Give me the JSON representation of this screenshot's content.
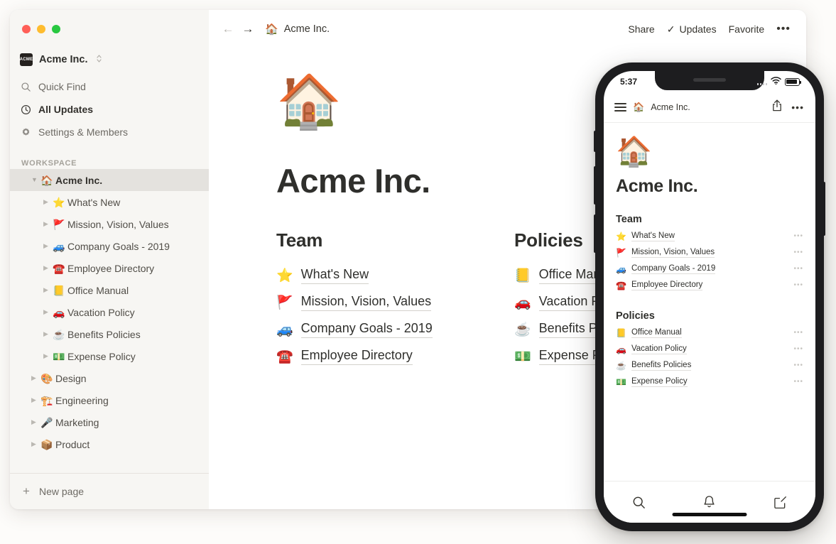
{
  "window": {
    "traffic_lights": [
      "close",
      "minimize",
      "maximize"
    ],
    "workspace_switcher": {
      "logo_text": "ACME",
      "name": "Acme Inc.",
      "chevron": "⌃⌄"
    },
    "nav": [
      {
        "label": "Quick Find",
        "icon": "search-icon"
      },
      {
        "label": "All Updates",
        "icon": "clock-icon"
      },
      {
        "label": "Settings & Members",
        "icon": "gear-icon"
      }
    ],
    "workspace_section_label": "WORKSPACE",
    "tree": [
      {
        "label": "Acme Inc.",
        "emoji": "🏠",
        "level": 0,
        "expanded": true,
        "selected": true
      },
      {
        "label": "What's New",
        "emoji": "⭐",
        "level": 1,
        "expanded": false,
        "selected": false
      },
      {
        "label": "Mission, Vision, Values",
        "emoji": "🚩",
        "level": 1,
        "expanded": false,
        "selected": false
      },
      {
        "label": "Company Goals - 2019",
        "emoji": "🚙",
        "level": 1,
        "expanded": false,
        "selected": false
      },
      {
        "label": "Employee Directory",
        "emoji": "☎️",
        "level": 1,
        "expanded": false,
        "selected": false
      },
      {
        "label": "Office Manual",
        "emoji": "📒",
        "level": 1,
        "expanded": false,
        "selected": false
      },
      {
        "label": "Vacation Policy",
        "emoji": "🚗",
        "level": 1,
        "expanded": false,
        "selected": false
      },
      {
        "label": "Benefits Policies",
        "emoji": "☕",
        "level": 1,
        "expanded": false,
        "selected": false
      },
      {
        "label": "Expense Policy",
        "emoji": "💵",
        "level": 1,
        "expanded": false,
        "selected": false
      },
      {
        "label": "Design",
        "emoji": "🎨",
        "level": 0,
        "expanded": false,
        "selected": false
      },
      {
        "label": "Engineering",
        "emoji": "🏗️",
        "level": 0,
        "expanded": false,
        "selected": false
      },
      {
        "label": "Marketing",
        "emoji": "🎤",
        "level": 0,
        "expanded": false,
        "selected": false
      },
      {
        "label": "Product",
        "emoji": "📦",
        "level": 0,
        "expanded": false,
        "selected": false
      }
    ],
    "new_page_label": "New page"
  },
  "topbar": {
    "back_arrow": "←",
    "forward_arrow": "→",
    "breadcrumb_emoji": "🏠",
    "breadcrumb_label": "Acme Inc.",
    "share_label": "Share",
    "updates_label": "Updates",
    "updates_check": "✓",
    "favorite_label": "Favorite",
    "more_label": "•••"
  },
  "page": {
    "emoji": "🏠",
    "title": "Acme Inc.",
    "columns": [
      {
        "heading": "Team",
        "links": [
          {
            "label": "What's New",
            "emoji": "⭐"
          },
          {
            "label": "Mission, Vision, Values",
            "emoji": "🚩"
          },
          {
            "label": "Company Goals - 2019",
            "emoji": "🚙"
          },
          {
            "label": "Employee Directory",
            "emoji": "☎️"
          }
        ]
      },
      {
        "heading": "Policies",
        "links": [
          {
            "label": "Office Manual",
            "emoji": "📒"
          },
          {
            "label": "Vacation Policy",
            "emoji": "🚗"
          },
          {
            "label": "Benefits Policies",
            "emoji": "☕"
          },
          {
            "label": "Expense Policy",
            "emoji": "💵"
          }
        ]
      }
    ]
  },
  "phone": {
    "status": {
      "time": "5:37",
      "signal_icon": "signal-bars-icon",
      "wifi_icon": "wifi-icon",
      "battery_icon": "battery-icon"
    },
    "header": {
      "menu_icon": "hamburger-menu-icon",
      "emoji": "🏠",
      "title": "Acme Inc.",
      "share_icon": "share-icon",
      "more_label": "•••"
    },
    "page": {
      "emoji": "🏠",
      "title": "Acme Inc.",
      "sections": [
        {
          "heading": "Team",
          "links": [
            {
              "label": "What's New",
              "emoji": "⭐",
              "more": "•••"
            },
            {
              "label": "Mission, Vision, Values",
              "emoji": "🚩",
              "more": "•••"
            },
            {
              "label": "Company Goals - 2019",
              "emoji": "🚙",
              "more": "•••"
            },
            {
              "label": "Employee Directory",
              "emoji": "☎️",
              "more": "•••"
            }
          ]
        },
        {
          "heading": "Policies",
          "links": [
            {
              "label": "Office Manual",
              "emoji": "📒",
              "more": "•••"
            },
            {
              "label": "Vacation Policy",
              "emoji": "🚗",
              "more": "•••"
            },
            {
              "label": "Benefits Policies",
              "emoji": "☕",
              "more": "•••"
            },
            {
              "label": "Expense Policy",
              "emoji": "💵",
              "more": "•••"
            }
          ]
        }
      ]
    },
    "tabbar": [
      {
        "icon": "search-icon"
      },
      {
        "icon": "bell-icon"
      },
      {
        "icon": "compose-icon"
      }
    ]
  },
  "colors": {
    "page_background": "#fdfcfa",
    "sidebar_background": "#f7f6f3",
    "content_background": "#ffffff",
    "selected_row": "#e4e2de",
    "text_primary": "#2f2f2c",
    "text_secondary": "#6d6a64",
    "traffic_red": "#ff5f57",
    "traffic_yellow": "#febc2e",
    "traffic_green": "#28c840",
    "phone_frame": "#1d1d1f"
  }
}
